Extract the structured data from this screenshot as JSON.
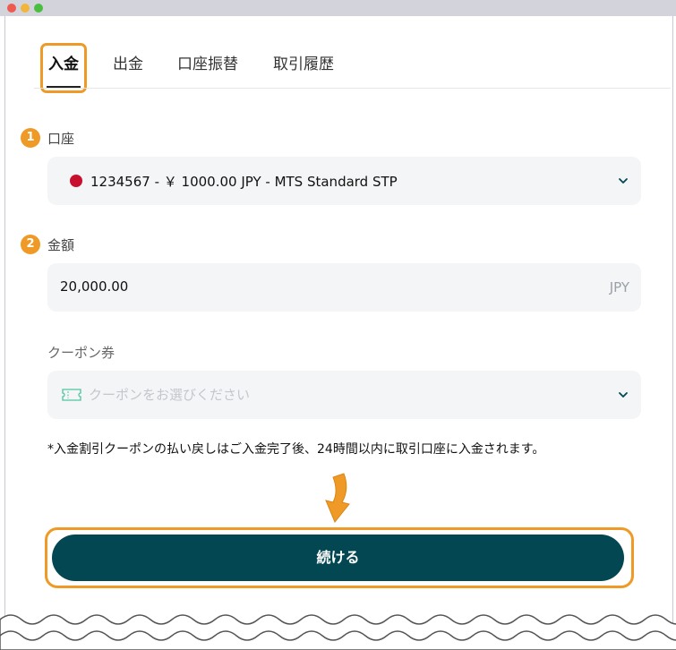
{
  "tabs": {
    "deposit": "入金",
    "withdraw": "出金",
    "transfer": "口座振替",
    "history": "取引履歴"
  },
  "steps": {
    "one": "1",
    "two": "2"
  },
  "account": {
    "label": "口座",
    "value": "1234567 - ￥ 1000.00 JPY - MTS Standard STP",
    "flag_color": "#c8102e"
  },
  "amount": {
    "label": "金額",
    "value": "20,000.00",
    "currency": "JPY"
  },
  "coupon": {
    "label": "クーポン券",
    "placeholder": "クーポンをお選びください"
  },
  "note": "*入金割引クーポンの払い戻しはご入金完了後、24時間以内に取引口座に入金されます。",
  "continue_label": "続ける",
  "colors": {
    "accent": "#ef9a26",
    "button": "#034752",
    "ticket_icon": "#4fc3a1"
  }
}
